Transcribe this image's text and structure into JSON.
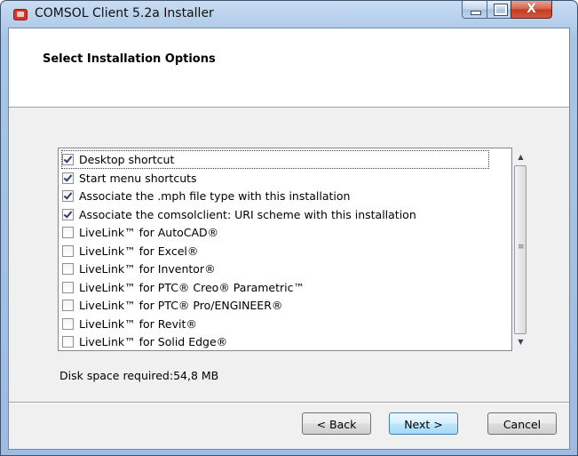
{
  "window": {
    "title": "COMSOL Client 5.2a Installer",
    "icon": "comsol-app-icon",
    "controls": {
      "minimize": "minimize-icon",
      "maximize": "maximize-icon",
      "close_glyph": "X"
    }
  },
  "header": {
    "title": "Select Installation Options"
  },
  "options": [
    {
      "label": "Desktop shortcut",
      "checked": true
    },
    {
      "label": "Start menu shortcuts",
      "checked": true
    },
    {
      "label": "Associate the .mph file type with this installation",
      "checked": true
    },
    {
      "label": "Associate the comsolclient: URI scheme with this installation",
      "checked": true
    },
    {
      "label": "LiveLink™ for AutoCAD®",
      "checked": false
    },
    {
      "label": "LiveLink™ for Excel®",
      "checked": false
    },
    {
      "label": "LiveLink™ for Inventor®",
      "checked": false
    },
    {
      "label": "LiveLink™ for PTC® Creo® Parametric™",
      "checked": false
    },
    {
      "label": "LiveLink™ for PTC® Pro/ENGINEER®",
      "checked": false
    },
    {
      "label": "LiveLink™ for Revit®",
      "checked": false
    },
    {
      "label": "LiveLink™ for Solid Edge®",
      "checked": false
    }
  ],
  "scrollbar": {
    "up_icon": "▲",
    "down_icon": "▼",
    "grip_icon": "≡"
  },
  "disk": {
    "label": "Disk space required:",
    "value": "54,8 MB"
  },
  "buttons": {
    "back": "< Back",
    "next": "Next >",
    "cancel": "Cancel"
  },
  "colors": {
    "title_accent": "#a9c5e6",
    "close_button": "#c23a22",
    "primary_button": "#a7d9f5"
  }
}
